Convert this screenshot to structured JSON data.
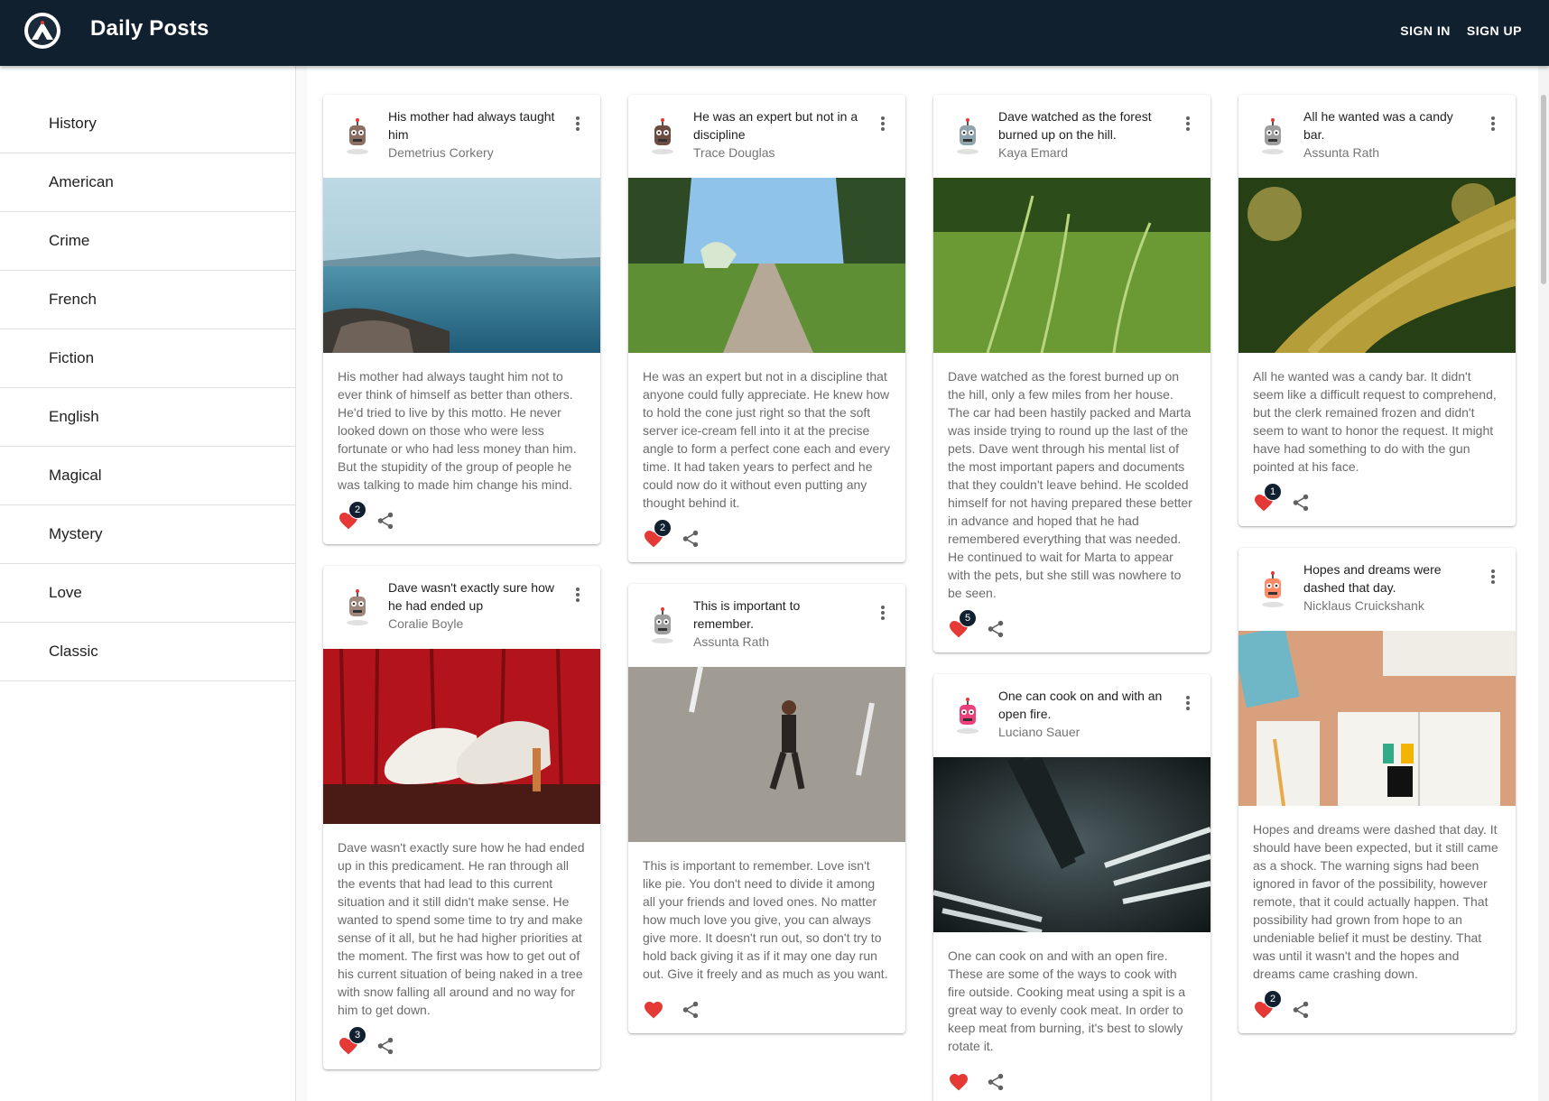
{
  "app": {
    "title": "Daily Posts",
    "sign_in": "SIGN IN",
    "sign_up": "SIGN UP"
  },
  "sidebar": {
    "items": [
      "History",
      "American",
      "Crime",
      "French",
      "Fiction",
      "English",
      "Magical",
      "Mystery",
      "Love",
      "Classic"
    ]
  },
  "colors": {
    "appbar": "#11202f",
    "heart": "#e53935",
    "badge": "#11202f"
  },
  "posts": [
    {
      "title": "His mother had always taught him",
      "author": "Demetrius Corkery",
      "body": "His mother had always taught him not to ever think of himself as better than others. He'd tried to live by this motto. He never looked down on those who were less fortunate or who had less money than him. But the stupidity of the group of people he was talking to made him change his mind.",
      "likes": "2",
      "image": "ocean-coast",
      "avatar_color": "#8d6e63"
    },
    {
      "title": "Dave wasn't exactly sure how he had ended up",
      "author": "Coralie Boyle",
      "body": "Dave wasn't exactly sure how he had ended up in this predicament. He ran through all the events that had lead to this current situation and it still didn't make sense. He wanted to spend some time to try and make sense of it all, but he had higher priorities at the moment. The first was how to get out of his current situation of being naked in a tree with snow falling all around and no way for him to get down.",
      "likes": "3",
      "image": "white-heels",
      "avatar_color": "#a1887f"
    },
    {
      "title": "He was an expert but not in a discipline",
      "author": "Trace Douglas",
      "body": "He was an expert but not in a discipline that anyone could fully appreciate. He knew how to hold the cone just right so that the soft server ice-cream fell into it at the precise angle to form a perfect cone each and every time. It had taken years to perfect and he could now do it without even putting any thought behind it.",
      "likes": "2",
      "image": "forest-path",
      "avatar_color": "#6d4c41"
    },
    {
      "title": "This is important to remember.",
      "author": "Assunta Rath",
      "body": "This is important to remember. Love isn't like pie. You don't need to divide it among all your friends and loved ones. No matter how much love you give, you can always give more. It doesn't run out, so don't try to hold back giving it as if it may one day run out. Give it freely and as much as you want.",
      "likes": "",
      "image": "man-walking",
      "avatar_color": "#9e9e9e"
    },
    {
      "title": "Dave watched as the forest burned up on the hill.",
      "author": "Kaya Emard",
      "body": "Dave watched as the forest burned up on the hill, only a few miles from her house. The car had been hastily packed and Marta was inside trying to round up the last of the pets. Dave went through his mental list of the most important papers and documents that they couldn't leave behind. He scolded himself for not having prepared these better in advance and hoped that he had remembered everything that was needed. He continued to wait for Marta to appear with the pets, but she still was nowhere to be seen.",
      "likes": "5",
      "image": "grass",
      "avatar_color": "#90a4ae"
    },
    {
      "title": "One can cook on and with an open fire.",
      "author": "Luciano Sauer",
      "body": "One can cook on and with an open fire. These are some of the ways to cook with fire outside. Cooking meat using a spit is a great way to evenly cook meat. In order to keep meat from burning, it's best to slowly rotate it.",
      "likes": "",
      "image": "forks",
      "avatar_color": "#ec407a"
    },
    {
      "title": "All he wanted was a candy bar.",
      "author": "Assunta Rath",
      "body": "All he wanted was a candy bar. It didn't seem like a difficult request to comprehend, but the clerk remained frozen and didn't seem to want to honor the request. It might have had something to do with the gun pointed at his face.",
      "likes": "1",
      "image": "moss",
      "avatar_color": "#9e9e9e"
    },
    {
      "title": "Hopes and dreams were dashed that day.",
      "author": "Nicklaus Cruickshank",
      "body": "Hopes and dreams were dashed that day. It should have been expected, but it still came as a shock. The warning signs had been ignored in favor of the possibility, however remote, that it could actually happen. That possibility had grown from hope to an undeniable belief it must be destiny. That was until it wasn't and the hopes and dreams came crashing down.",
      "likes": "2",
      "image": "desk",
      "avatar_color": "#ff8a65"
    }
  ]
}
